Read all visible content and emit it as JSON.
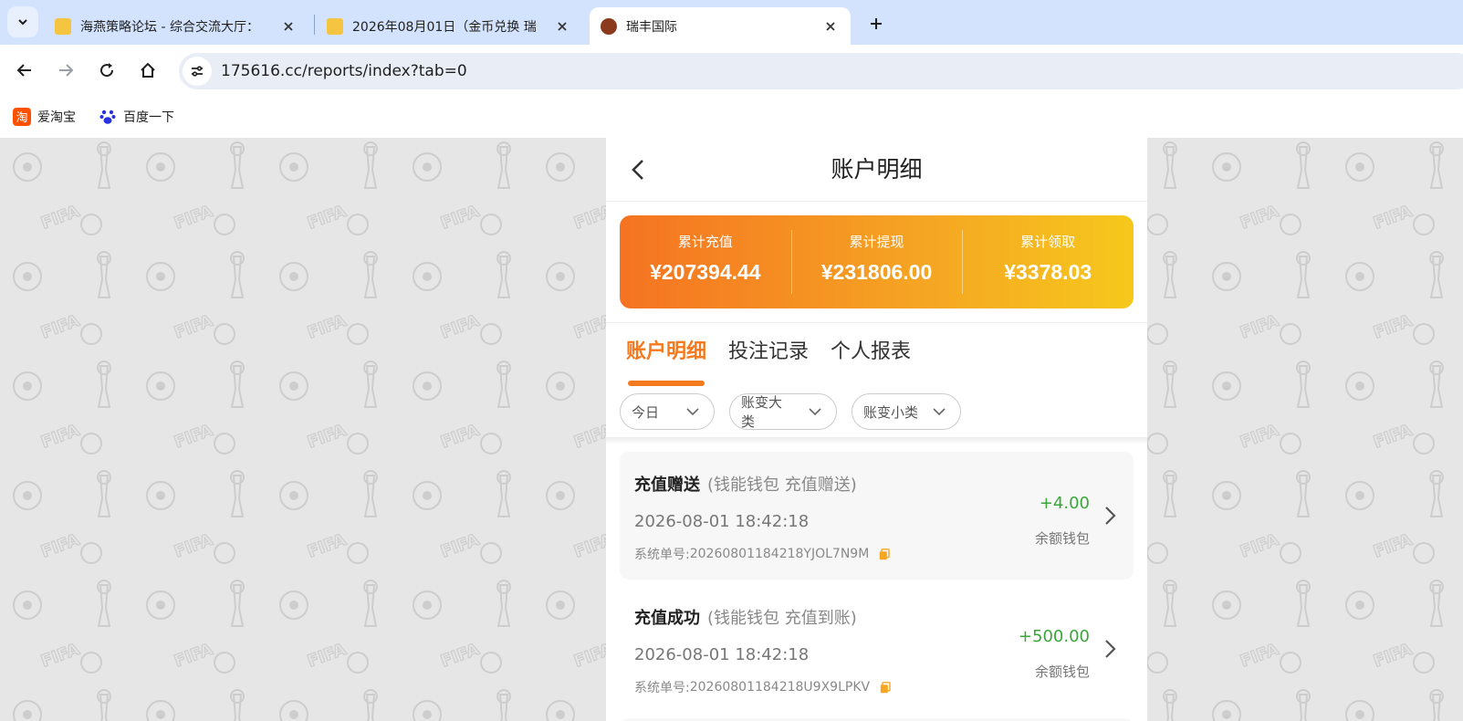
{
  "browser": {
    "tabs": [
      {
        "title": "海燕策略论坛 - 综合交流大厅：",
        "favicon_color": "#f5c542"
      },
      {
        "title": "2026年08月01日（金币兑换 瑞",
        "favicon_color": "#f5c542"
      },
      {
        "title": "瑞丰国际",
        "favicon_color": "#8b3a1e"
      }
    ],
    "url": "175616.cc/reports/index?tab=0",
    "bookmarks": [
      {
        "label": "爱淘宝",
        "icon": "taobao-icon",
        "color": "#ff5000"
      },
      {
        "label": "百度一下",
        "icon": "baidu-paw-icon",
        "color": "#2932e1"
      }
    ]
  },
  "page": {
    "title": "账户明细",
    "summary": [
      {
        "label": "累计充值",
        "value": "¥207394.44"
      },
      {
        "label": "累计提现",
        "value": "¥231806.00"
      },
      {
        "label": "累计领取",
        "value": "¥3378.03"
      }
    ],
    "tabs": [
      {
        "label": "账户明细",
        "active": true
      },
      {
        "label": "投注记录",
        "active": false
      },
      {
        "label": "个人报表",
        "active": false
      }
    ],
    "filters": [
      {
        "label": "今日"
      },
      {
        "label": "账变大类"
      },
      {
        "label": "账变小类"
      }
    ],
    "records": [
      {
        "title": "充值赠送",
        "subtitle": "(钱能钱包 充值赠送)",
        "time": "2026-08-01 18:42:18",
        "order_label": "系统单号:",
        "order_no": "20260801184218YJOL7N9M",
        "amount": "+4.00",
        "wallet": "余额钱包"
      },
      {
        "title": "充值成功",
        "subtitle": "(钱能钱包 充值到账)",
        "time": "2026-08-01 18:42:18",
        "order_label": "系统单号:",
        "order_no": "20260801184218U9X9LPKV",
        "amount": "+500.00",
        "wallet": "余额钱包"
      }
    ]
  },
  "colors": {
    "accent": "#f57a1f",
    "positive": "#3aa63a",
    "gradient_start": "#f57322",
    "gradient_end": "#f6c81c"
  }
}
